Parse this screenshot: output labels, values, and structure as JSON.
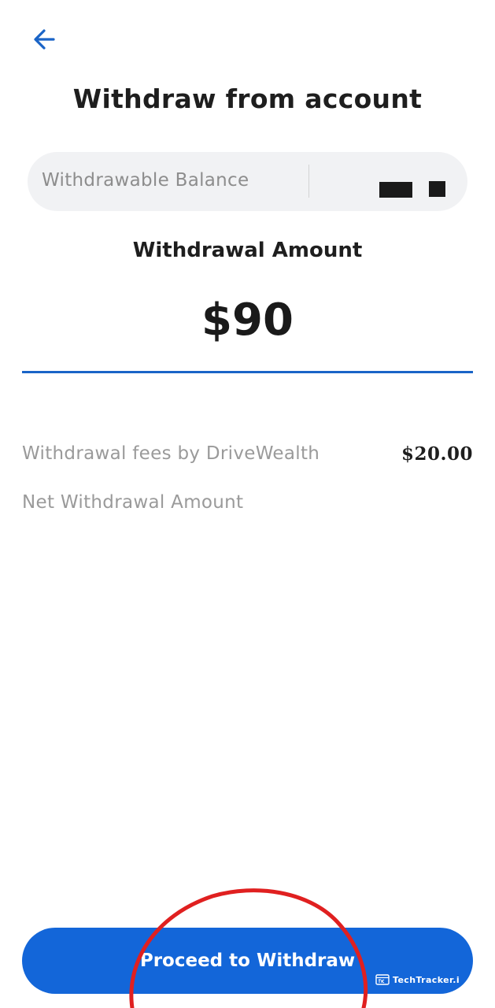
{
  "header": {
    "back_icon": "arrow-left-icon",
    "title": "Withdraw from account"
  },
  "balance": {
    "label": "Withdrawable Balance",
    "value_state": "redacted"
  },
  "amount": {
    "label": "Withdrawal Amount",
    "value": "$90"
  },
  "details": {
    "fee_label": "Withdrawal fees by DriveWealth",
    "fee_value": "$20.00",
    "net_label": "Net Withdrawal Amount"
  },
  "footer": {
    "proceed_label": "Proceed to Withdraw"
  },
  "watermark": {
    "text": "TechTracker.i"
  },
  "colors": {
    "accent": "#1366d9",
    "underline": "#1a64c7",
    "highlight_circle": "#e02020",
    "pill_bg": "#f1f2f4"
  }
}
